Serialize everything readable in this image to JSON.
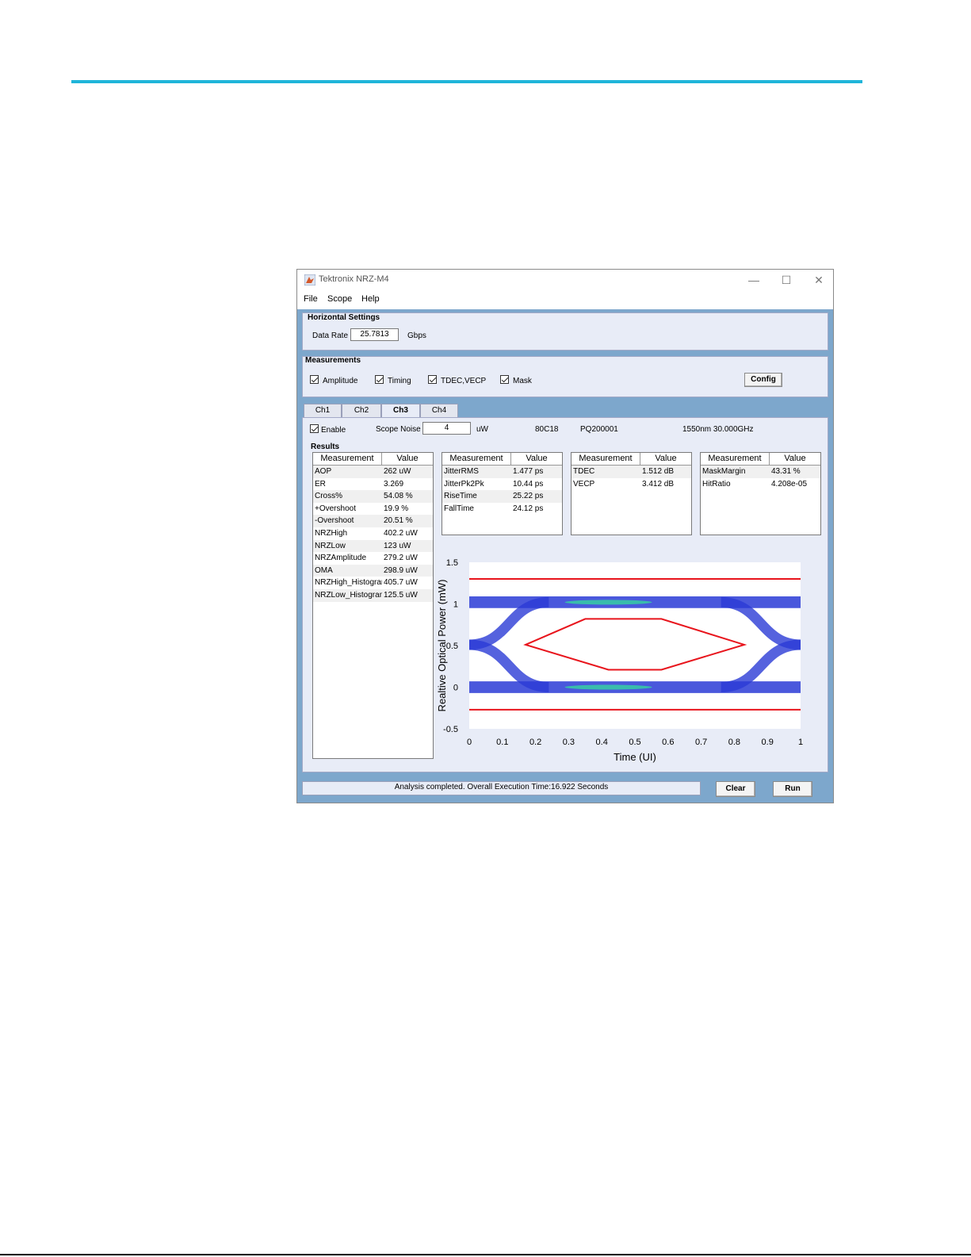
{
  "window": {
    "title": "Tektronix NRZ-M4",
    "minimize": "—",
    "maximize": "☐",
    "close": "✕"
  },
  "menu": [
    "File",
    "Scope",
    "Help"
  ],
  "horizontal": {
    "group_label": "Horizontal Settings",
    "data_rate_label": "Data Rate",
    "data_rate_value": "25.7813",
    "unit": "Gbps"
  },
  "measurements": {
    "group_label": "Measurements",
    "checks": [
      {
        "label": "Amplitude",
        "checked": true
      },
      {
        "label": "Timing",
        "checked": true
      },
      {
        "label": "TDEC,VECP",
        "checked": true
      },
      {
        "label": "Mask",
        "checked": true
      }
    ],
    "config_button": "Config"
  },
  "tabs": [
    "Ch1",
    "Ch2",
    "Ch3",
    "Ch4"
  ],
  "active_tab": "Ch3",
  "channel": {
    "enable_label": "Enable",
    "enable_checked": true,
    "scope_noise_label": "Scope Noise",
    "scope_noise_value": "4",
    "scope_noise_unit": "uW",
    "module": "80C18",
    "serial": "PQ200001",
    "wavelength": "1550nm 30.000GHz"
  },
  "results": {
    "label": "Results",
    "tables": [
      {
        "headers": [
          "Measurement",
          "Value"
        ],
        "rows": [
          [
            "AOP",
            "262  uW"
          ],
          [
            "ER",
            "3.269"
          ],
          [
            "Cross%",
            "54.08  %"
          ],
          [
            "+Overshoot",
            "19.9  %"
          ],
          [
            "-Overshoot",
            "20.51  %"
          ],
          [
            "NRZHigh",
            "402.2  uW"
          ],
          [
            "NRZLow",
            "123  uW"
          ],
          [
            "NRZAmplitude",
            "279.2  uW"
          ],
          [
            "OMA",
            "298.9  uW"
          ],
          [
            "NRZHigh_Histogram",
            "405.7  uW"
          ],
          [
            "NRZLow_Histogram",
            "125.5  uW"
          ]
        ]
      },
      {
        "headers": [
          "Measurement",
          "Value"
        ],
        "rows": [
          [
            "JitterRMS",
            "1.477  ps"
          ],
          [
            "JitterPk2Pk",
            "10.44  ps"
          ],
          [
            "RiseTime",
            "25.22  ps"
          ],
          [
            "FallTime",
            "24.12  ps"
          ]
        ]
      },
      {
        "headers": [
          "Measurement",
          "Value"
        ],
        "rows": [
          [
            "TDEC",
            "1.512  dB"
          ],
          [
            "VECP",
            "3.412  dB"
          ]
        ]
      },
      {
        "headers": [
          "Measurement",
          "Value"
        ],
        "rows": [
          [
            "MaskMargin",
            "43.31  %"
          ],
          [
            "HitRatio",
            "4.208e-05"
          ]
        ]
      }
    ]
  },
  "status": {
    "message": "Analysis completed. Overall Execution Time:16.922 Seconds",
    "clear_button": "Clear",
    "run_button": "Run"
  },
  "colors": {
    "accent_rule": "#1fb5d9",
    "window_frame": "#7da7cc",
    "panel": "#e8ecf7",
    "mask": "#e8141c",
    "eye_blue": "#2a3bd6",
    "eye_hot": "#35d6a0"
  },
  "chart_data": {
    "type": "eye-diagram",
    "xlabel": "Time (UI)",
    "ylabel": "Realtive Optical Power (mW)",
    "xlim": [
      0,
      1
    ],
    "ylim": [
      -0.5,
      1.5
    ],
    "xticks": [
      "0",
      "0.1",
      "0.2",
      "0.3",
      "0.4",
      "0.5",
      "0.6",
      "0.7",
      "0.8",
      "0.9",
      "1"
    ],
    "yticks": [
      "1.5",
      "1",
      "0.5",
      "0",
      "-0.5"
    ],
    "eye": {
      "high_level": 1.02,
      "low_level": 0.0,
      "cross_points": [
        0.0,
        1.0
      ],
      "band_width": 0.07
    },
    "mask": {
      "upper_limit": 1.3,
      "lower_limit": -0.27,
      "center_polygon": [
        [
          0.17,
          0.51
        ],
        [
          0.35,
          0.82
        ],
        [
          0.58,
          0.82
        ],
        [
          0.83,
          0.51
        ],
        [
          0.58,
          0.21
        ],
        [
          0.42,
          0.21
        ]
      ]
    }
  }
}
